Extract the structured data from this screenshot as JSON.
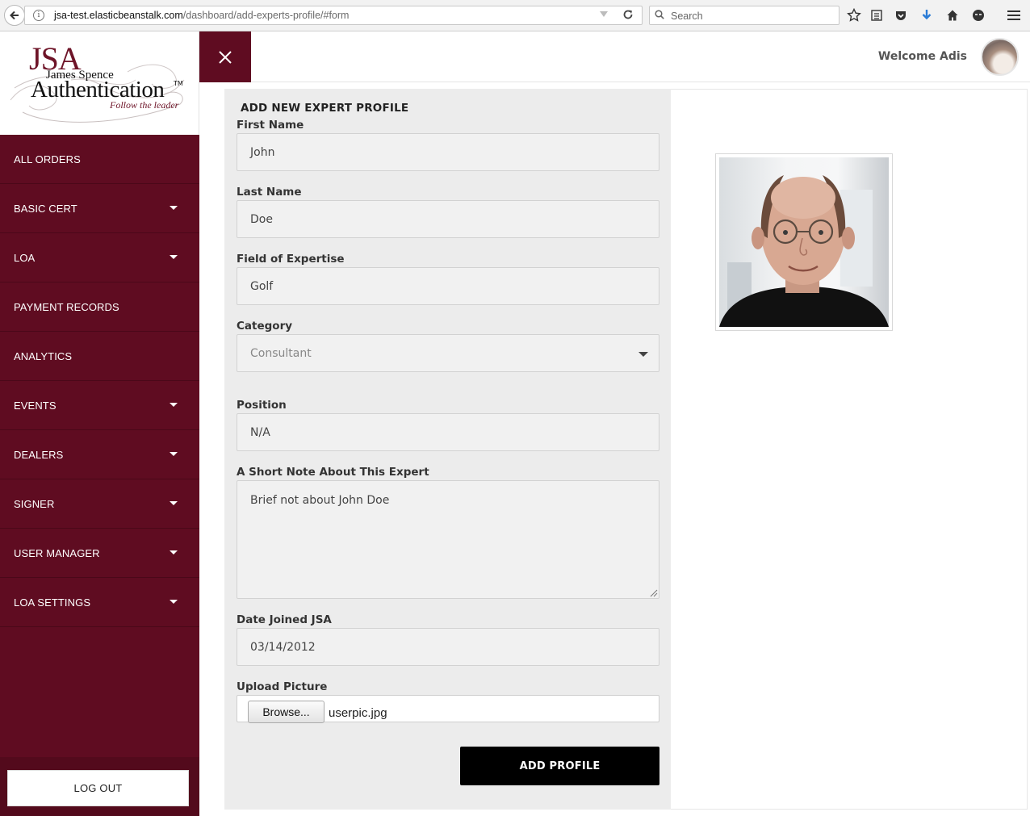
{
  "browser": {
    "url_domain": "jsa-test.elasticbeanstalk.com",
    "url_path": "/dashboard/add-experts-profile/#form",
    "search_placeholder": "Search"
  },
  "logo": {
    "jsa": "JSA",
    "name": "James Spence",
    "auth": "Authentication",
    "tm": "TM",
    "tagline": "Follow the leader"
  },
  "sidebar": {
    "items": [
      {
        "label": "ALL ORDERS",
        "has_caret": false
      },
      {
        "label": "BASIC CERT",
        "has_caret": true
      },
      {
        "label": "LOA",
        "has_caret": true
      },
      {
        "label": "PAYMENT RECORDS",
        "has_caret": false
      },
      {
        "label": "ANALYTICS",
        "has_caret": false
      },
      {
        "label": "EVENTS",
        "has_caret": true
      },
      {
        "label": "DEALERS",
        "has_caret": true
      },
      {
        "label": "SIGNER",
        "has_caret": true
      },
      {
        "label": "USER MANAGER",
        "has_caret": true
      },
      {
        "label": "LOA SETTINGS",
        "has_caret": true
      }
    ],
    "logout_label": "LOG OUT"
  },
  "header": {
    "welcome": "Welcome Adis"
  },
  "form": {
    "title": "ADD NEW EXPERT PROFILE",
    "first_name": {
      "label": "First Name",
      "value": "John"
    },
    "last_name": {
      "label": "Last Name",
      "value": "Doe"
    },
    "expertise": {
      "label": "Field of Expertise",
      "value": "Golf"
    },
    "category": {
      "label": "Category",
      "value": "Consultant"
    },
    "position": {
      "label": "Position",
      "value": "N/A"
    },
    "note": {
      "label": "A Short Note About This Expert",
      "value": "Brief not about John Doe"
    },
    "date_joined": {
      "label": "Date Joined JSA",
      "value": "03/14/2012"
    },
    "upload": {
      "label": "Upload Picture",
      "button": "Browse...",
      "file": "userpic.jpg"
    },
    "submit_label": "ADD PROFILE"
  },
  "colors": {
    "sidebar_bg": "#5f0c21",
    "form_bg": "#ececec",
    "button_bg": "#000000"
  }
}
